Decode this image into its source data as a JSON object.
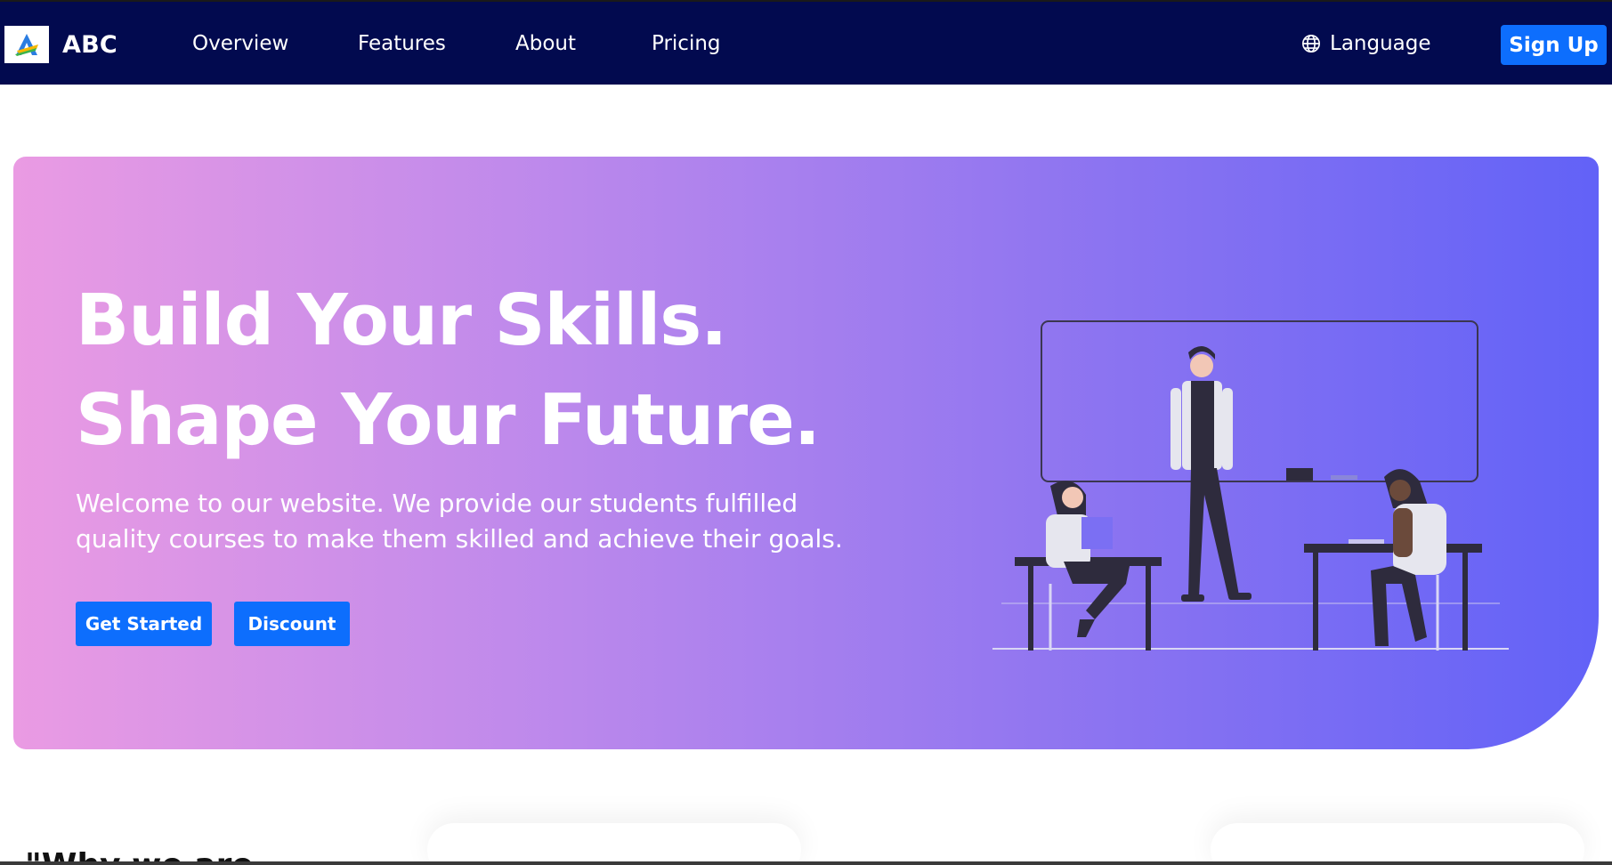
{
  "navbar": {
    "brand": "ABC",
    "links": [
      "Overview",
      "Features",
      "About",
      "Pricing"
    ],
    "language": "Language",
    "signup": "Sign Up"
  },
  "hero": {
    "title_line1": "Build Your Skills.",
    "title_line2": "Shape Your Future.",
    "subtitle": "Welcome to our website. We provide our students fulfilled quality courses to make them skilled and achieve their goals.",
    "buttons": [
      "Get Started",
      "Discount"
    ]
  },
  "next_section": {
    "heading_peek": "\"Why we are"
  },
  "colors": {
    "navbar": "#020a4f",
    "primary_button": "#0d6efd",
    "hero_gradient_start": "#ea9be3",
    "hero_gradient_end": "#6262f7"
  },
  "icons": [
    "abc-logo-icon",
    "globe-icon",
    "classroom-illustration"
  ]
}
